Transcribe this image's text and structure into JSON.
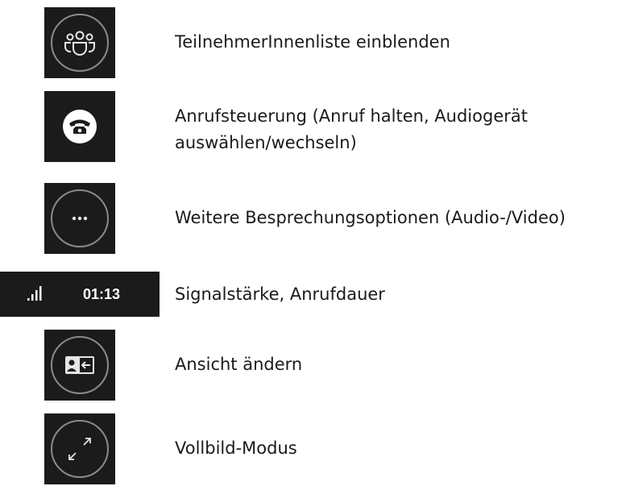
{
  "items": [
    {
      "icon": "people-icon",
      "label": "TeilnehmerInnenliste einblenden"
    },
    {
      "icon": "phone-icon",
      "label_line1": "Anrufsteuerung (Anruf halten, Audiogerät",
      "label_line2": "auswählen/wechseln)"
    },
    {
      "icon": "more-options-icon",
      "label": "Weitere Besprechungsoptionen (Audio-/Video)"
    },
    {
      "icon": "signal-strength-icon",
      "timer": "01:13",
      "label": "Signalstärke, Anrufdauer"
    },
    {
      "icon": "change-view-icon",
      "label": "Ansicht ändern"
    },
    {
      "icon": "fullscreen-icon",
      "label": "Vollbild-Modus"
    }
  ],
  "colors": {
    "tile_background": "#1b1b1b",
    "icon_stroke": "#8a8a8a",
    "icon_fill": "#ffffff",
    "text": "#1a1a1a"
  }
}
